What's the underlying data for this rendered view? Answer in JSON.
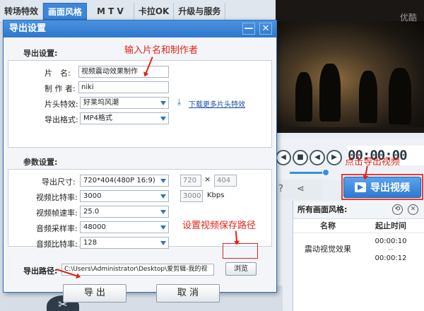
{
  "app": {
    "tabs": [
      "转场特效",
      "画面风格",
      "M T V",
      "卡拉OK",
      "升级与服务"
    ],
    "video_watermark": "优酷",
    "timecode": "00:00:00",
    "export_video_label": "导出视频",
    "effects_panel": {
      "title": "所有画面风格:",
      "col_name": "名称",
      "col_time": "起止时间",
      "row_name": "震动视觉效果",
      "row_start": "00:00:10",
      "row_end": "00:00:12"
    }
  },
  "dialog": {
    "title": "导出设置",
    "minimize_glyph": "—",
    "close_glyph": "✕",
    "export_section": {
      "title": "导出设置:",
      "name_label": "片　名:",
      "name_value": "视频震动效果制作",
      "author_label": "制 作 者:",
      "author_value": "niki",
      "intro_label": "片头特效:",
      "intro_value": "好莱坞风潮",
      "download_link": "下载更多片头特效",
      "format_label": "导出格式:",
      "format_value": "MP4格式"
    },
    "param_section": {
      "title": "参数设置:",
      "size_label": "导出尺寸:",
      "size_value": "720*404(480P 16:9)",
      "width_value": "720",
      "times_glyph": "×",
      "height_value": "404",
      "vbitrate_label": "视频比特率:",
      "vbitrate_value": "3000",
      "vbitrate_custom": "3000",
      "kbps": "Kbps",
      "fps_label": "视频帧速率:",
      "fps_value": "25.0",
      "asample_label": "音频采样率:",
      "asample_value": "48000",
      "abitrate_label": "音频比特率:",
      "abitrate_value": "128"
    },
    "path": {
      "label": "导出路径:",
      "value": "C:\\Users\\Administrator\\Desktop\\爱剪辑-我的视",
      "browse": "浏览"
    },
    "export_button": "导 出",
    "cancel_button": "取 消"
  },
  "annotations": {
    "name_hint": "输入片名和制作者",
    "export_hint": "点击导出视频",
    "path_hint": "设置视频保存路径"
  },
  "colors": {
    "accent": "#2f77cc",
    "annotation": "#e0241a"
  }
}
